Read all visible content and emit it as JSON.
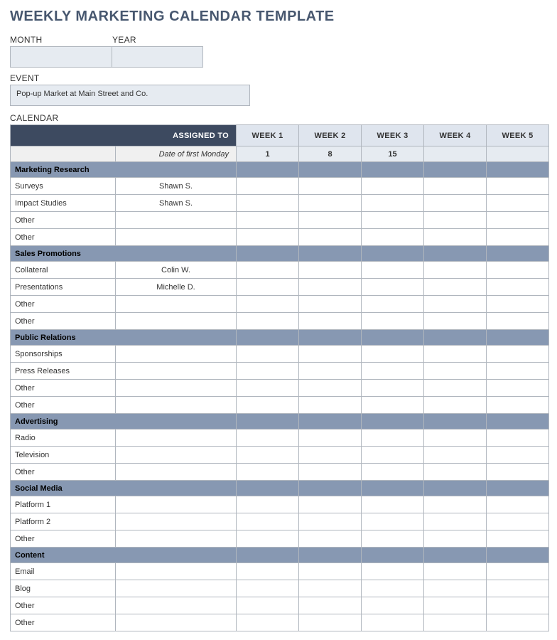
{
  "title": "WEEKLY MARKETING CALENDAR TEMPLATE",
  "fields": {
    "month_label": "MONTH",
    "year_label": "YEAR",
    "event_label": "EVENT",
    "month_value": "",
    "year_value": "",
    "event_value": "Pop-up Market at Main Street and Co."
  },
  "calendar_label": "CALENDAR",
  "header": {
    "assigned_to": "ASSIGNED TO",
    "weeks": [
      "WEEK 1",
      "WEEK 2",
      "WEEK 3",
      "WEEK 4",
      "WEEK 5"
    ],
    "first_monday_label": "Date of first Monday",
    "first_monday_values": [
      "1",
      "8",
      "15",
      "",
      ""
    ]
  },
  "sections": [
    {
      "name": "Marketing Research",
      "rows": [
        {
          "task": "Surveys",
          "assignee": "Shawn S."
        },
        {
          "task": "Impact Studies",
          "assignee": "Shawn S."
        },
        {
          "task": "Other",
          "assignee": ""
        },
        {
          "task": "Other",
          "assignee": ""
        }
      ]
    },
    {
      "name": "Sales Promotions",
      "rows": [
        {
          "task": "Collateral",
          "assignee": "Colin W."
        },
        {
          "task": "Presentations",
          "assignee": "Michelle D."
        },
        {
          "task": "Other",
          "assignee": ""
        },
        {
          "task": "Other",
          "assignee": ""
        }
      ]
    },
    {
      "name": "Public Relations",
      "rows": [
        {
          "task": "Sponsorships",
          "assignee": ""
        },
        {
          "task": "Press Releases",
          "assignee": ""
        },
        {
          "task": "Other",
          "assignee": ""
        },
        {
          "task": "Other",
          "assignee": ""
        }
      ]
    },
    {
      "name": "Advertising",
      "rows": [
        {
          "task": "Radio",
          "assignee": ""
        },
        {
          "task": "Television",
          "assignee": ""
        },
        {
          "task": "Other",
          "assignee": ""
        }
      ]
    },
    {
      "name": "Social Media",
      "rows": [
        {
          "task": "Platform 1",
          "assignee": ""
        },
        {
          "task": "Platform 2",
          "assignee": ""
        },
        {
          "task": "Other",
          "assignee": ""
        }
      ]
    },
    {
      "name": "Content",
      "rows": [
        {
          "task": "Email",
          "assignee": ""
        },
        {
          "task": "Blog",
          "assignee": ""
        },
        {
          "task": "Other",
          "assignee": ""
        },
        {
          "task": "Other",
          "assignee": ""
        }
      ]
    }
  ]
}
